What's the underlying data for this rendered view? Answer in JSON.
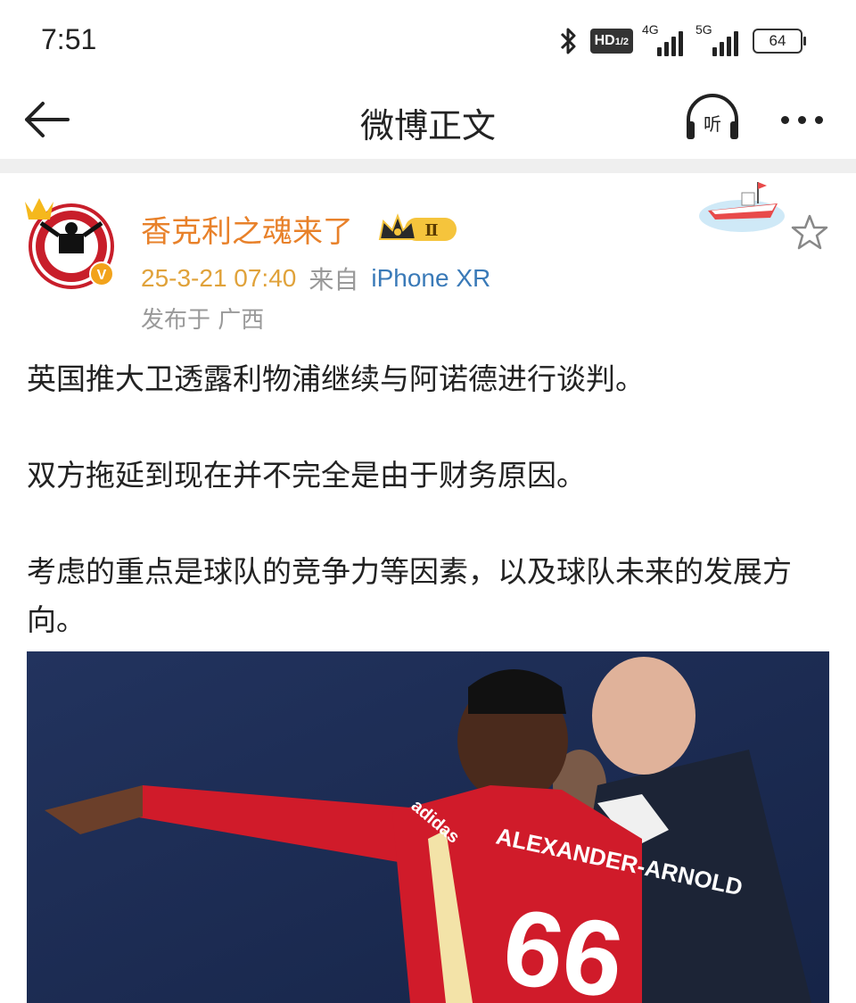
{
  "status_bar": {
    "time": "7:51",
    "hd_label": "HD",
    "hd_sub": "1/2",
    "network_4g": "4G",
    "network_5g": "5G",
    "battery": "64"
  },
  "nav": {
    "back_icon": "arrow-left-icon",
    "title": "微博正文",
    "listen_label": "听",
    "more_icon": "more-dots-icon"
  },
  "post": {
    "author": "香克利之魂来了",
    "vip_level": "Ⅱ",
    "timestamp": "25-3-21 07:40",
    "source_prefix": "来自",
    "device": "iPhone XR",
    "location": "发布于 广西",
    "paragraphs": [
      "英国推大卫透露利物浦继续与阿诺德进行谈判。",
      "双方拖延到现在并不完全是由于财务原因。",
      "考虑的重点是球队的竞争力等因素，以及球队未来的发展方向。"
    ],
    "photo": {
      "jersey_name": "ALEXANDER-ARNOLD",
      "jersey_number": "66",
      "sleeve_text": "adidas"
    }
  },
  "avatar": {
    "ring_text": "SPIRIT OF SHANKLY",
    "bottom_text": "LIVERPOOL"
  },
  "colors": {
    "username": "#e8812a",
    "timestamp": "#e0a23a",
    "device": "#3a7ab8",
    "verified_badge": "#f2a31b"
  }
}
